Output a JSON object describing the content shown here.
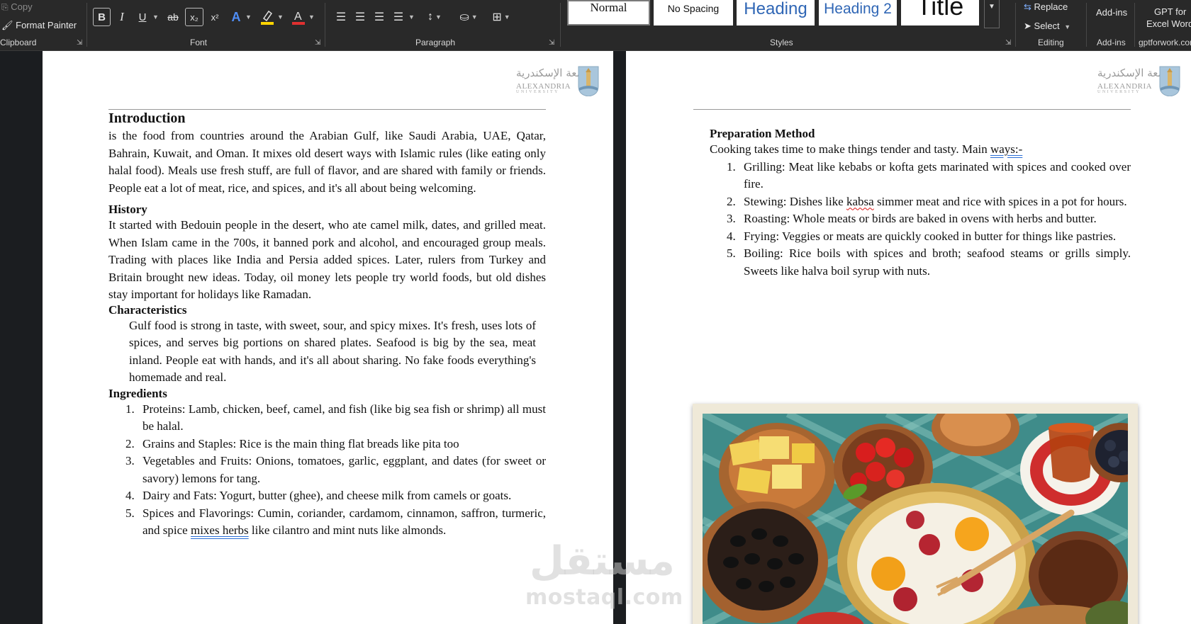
{
  "ribbon": {
    "clipboard": {
      "copy_label": "Copy",
      "format_painter_label": "Format Painter",
      "group_label": "Clipboard"
    },
    "font": {
      "group_label": "Font",
      "bold": "B",
      "italic": "I",
      "underline": "U",
      "strikethrough": "ab",
      "subscript": "x₂",
      "superscript": "x²",
      "text_effects": "A",
      "font_color": "A",
      "highlight_color": "#ffd400",
      "font_color_value": "#e03030"
    },
    "paragraph": {
      "group_label": "Paragraph"
    },
    "styles": {
      "group_label": "Styles",
      "items": [
        {
          "label": "Normal"
        },
        {
          "label": "No Spacing"
        },
        {
          "label": "Heading"
        },
        {
          "label": "Heading 2"
        },
        {
          "label": "Title"
        }
      ]
    },
    "editing": {
      "replace_label": "Replace",
      "select_label": "Select",
      "group_label": "Editing"
    },
    "addins": {
      "label": "Add-ins",
      "group_label": "Add-ins"
    },
    "gpt": {
      "line1": "GPT for",
      "line2": "Excel Word",
      "group_label": "gptforwork.com"
    }
  },
  "logo": {
    "arabic": "جامعة الإسكندرية",
    "english": "ALEXANDRIA",
    "sub": "UNIVERSITY"
  },
  "page_left": {
    "intro_heading": "Introduction",
    "intro_text": "is the food from countries around the Arabian Gulf, like Saudi Arabia, UAE, Qatar, Bahrain, Kuwait, and Oman. It mixes old desert ways with Islamic rules (like eating only halal food). Meals use fresh stuff, are full of flavor, and are shared with family or friends. People eat a lot of meat, rice, and spices, and it's all about being welcoming.",
    "history_heading": "History",
    "history_text": "It started with Bedouin people in the desert, who ate camel milk, dates, and grilled meat. When Islam came in the 700s, it banned pork and alcohol, and encouraged group meals. Trading with places like India and Persia added spices. Later, rulers from Turkey and Britain brought new ideas. Today, oil money lets people try world foods, but old dishes stay important for holidays like Ramadan.",
    "characteristics_heading": "Characteristics",
    "characteristics_text": "Gulf food is strong in taste, with sweet, sour, and spicy mixes. It's fresh, uses lots of spices, and serves big portions on shared plates. Seafood is big by the sea, meat inland. People eat with hands, and it's all about sharing. No fake foods everything's homemade and real.",
    "ingredients_heading": "Ingredients",
    "ingredients": [
      {
        "num": "1.",
        "text": "Proteins: Lamb, chicken, beef, camel, and fish (like big sea fish or shrimp) all must be halal."
      },
      {
        "num": "2.",
        "text": "Grains and Staples: Rice is the main thing flat breads like pita too"
      },
      {
        "num": "3.",
        "text": "Vegetables and Fruits: Onions, tomatoes, garlic, eggplant, and dates (for sweet or savory) lemons for tang."
      },
      {
        "num": "4.",
        "text": "Dairy and Fats: Yogurt, butter (ghee), and cheese milk from camels or goats."
      },
      {
        "num": "5.",
        "text_before": "Spices and Flavorings: Cumin, coriander, cardamom, cinnamon, saffron, turmeric, and spice ",
        "text_marked": "mixes  herbs",
        "text_after": " like cilantro and mint nuts like almonds."
      }
    ]
  },
  "page_right": {
    "prep_heading": "Preparation Method",
    "prep_intro_before": "Cooking takes time to make things tender and tasty. Main ",
    "prep_intro_marked": "ways:-",
    "methods": [
      {
        "num": "1.",
        "text": "Grilling: Meat like kebabs or kofta gets marinated with spices and cooked over fire."
      },
      {
        "num": "2.",
        "text_before": "Stewing: Dishes like ",
        "text_marked": "kabsa",
        "text_after": " simmer meat and rice with spices in a pot for hours."
      },
      {
        "num": "3.",
        "text": "Roasting: Whole meats or birds are baked in ovens with herbs and butter."
      },
      {
        "num": "4.",
        "text": "Frying: Veggies or meats are quickly cooked in butter for things like pastries."
      },
      {
        "num": "5.",
        "text": "Boiling: Rice boils with spices and broth; seafood steams or grills simply. Sweets like halva boil syrup with nuts."
      }
    ]
  },
  "watermark": {
    "arabic": "مستقل",
    "latin": "mostaql.com"
  }
}
